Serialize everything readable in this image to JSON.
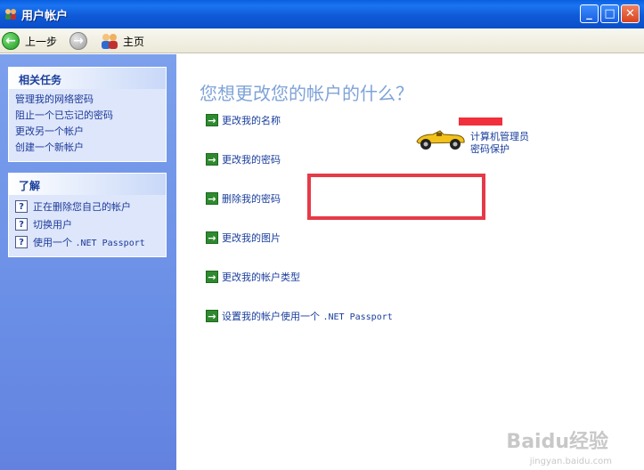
{
  "window": {
    "title": "用户帐户",
    "controls": {
      "minimize": "_",
      "maximize": "□",
      "close": "✕"
    }
  },
  "toolbar": {
    "back_label": "上一步",
    "home_label": "主页"
  },
  "left_panel": {
    "related_tasks": {
      "title": "相关任务",
      "items": [
        "管理我的网络密码",
        "阻止一个已忘记的密码",
        "更改另一个帐户",
        "创建一个新帐户"
      ]
    },
    "learn_about": {
      "title": "了解",
      "items": [
        {
          "label": "正在删除您自己的帐户"
        },
        {
          "label": "切换用户"
        },
        {
          "label_prefix": "使用一个 ",
          "label_mono": ".NET Passport"
        }
      ]
    }
  },
  "main": {
    "heading": "您想更改您的帐户的什么？",
    "options": [
      {
        "label": "更改我的名称"
      },
      {
        "label": "更改我的密码"
      },
      {
        "label": "删除我的密码"
      },
      {
        "label": "更改我的图片"
      },
      {
        "label": "更改我的帐户类型"
      },
      {
        "label_prefix": "设置我的帐户使用一个 ",
        "label_mono": ".NET Passport"
      }
    ],
    "account": {
      "type": "计算机管理员",
      "status": "密码保护"
    }
  },
  "watermark": {
    "brand": "Baidu经验",
    "url": "jingyan.baidu.com"
  },
  "colors": {
    "titlebar": "#0a5fe0",
    "left_panel": "#7ca0ec",
    "link": "#1e3a9a",
    "highlight_box": "#e63a48",
    "arrow_icon": "#2f8a2f"
  },
  "icons": [
    "users-icon",
    "back-arrow-icon",
    "forward-arrow-icon",
    "home-users-icon",
    "help-icon",
    "green-arrow-icon",
    "race-car-icon"
  ]
}
